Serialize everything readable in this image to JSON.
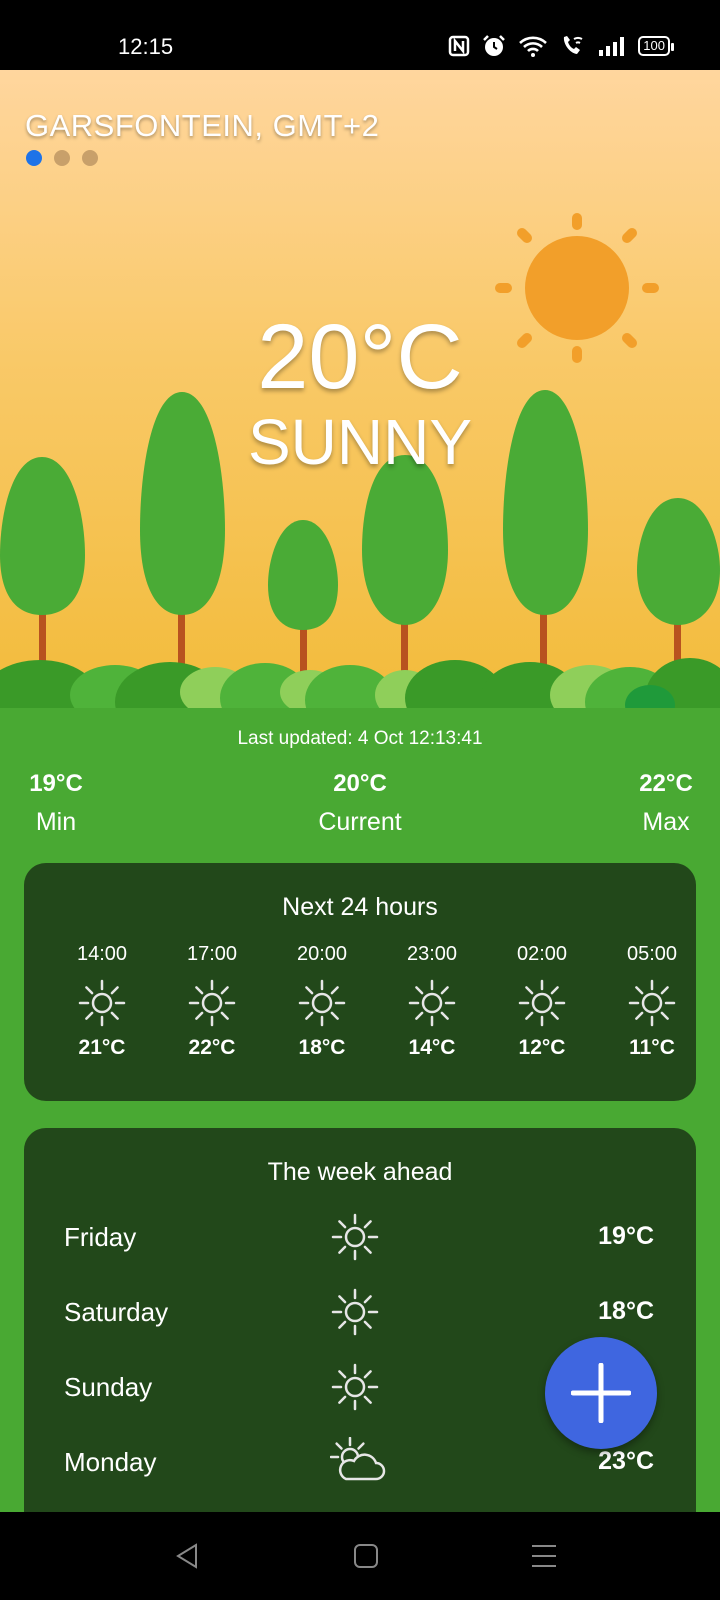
{
  "status_bar": {
    "time": "12:15",
    "battery": "100",
    "icons": [
      "nfc-icon",
      "alarm-icon",
      "wifi-icon",
      "wifi-call-icon",
      "signal-icon",
      "battery-icon"
    ]
  },
  "hero": {
    "location": "GARSFONTEIN, GMT+2",
    "page_dots": 3,
    "active_dot": 0,
    "temperature": "20°C",
    "condition": "SUNNY"
  },
  "summary": {
    "last_updated": "Last updated: 4 Oct 12:13:41",
    "min": {
      "value": "19°C",
      "label": "Min"
    },
    "current": {
      "value": "20°C",
      "label": "Current"
    },
    "max": {
      "value": "22°C",
      "label": "Max"
    }
  },
  "hourly": {
    "title": "Next 24 hours",
    "items": [
      {
        "time": "14:00",
        "icon": "sun-icon",
        "temp": "21°C"
      },
      {
        "time": "17:00",
        "icon": "sun-icon",
        "temp": "22°C"
      },
      {
        "time": "20:00",
        "icon": "sun-icon",
        "temp": "18°C"
      },
      {
        "time": "23:00",
        "icon": "sun-icon",
        "temp": "14°C"
      },
      {
        "time": "02:00",
        "icon": "sun-icon",
        "temp": "12°C"
      },
      {
        "time": "05:00",
        "icon": "sun-icon",
        "temp": "11°C"
      }
    ]
  },
  "weekly": {
    "title": "The week ahead",
    "items": [
      {
        "day": "Friday",
        "icon": "sun-icon",
        "temp": "19°C"
      },
      {
        "day": "Saturday",
        "icon": "sun-icon",
        "temp": "18°C"
      },
      {
        "day": "Sunday",
        "icon": "sun-icon",
        "temp": ""
      },
      {
        "day": "Monday",
        "icon": "partly-cloudy-icon",
        "temp": "23°C"
      }
    ]
  },
  "fab": {
    "icon": "plus-icon"
  },
  "colors": {
    "sky_top": "#ffd69e",
    "sky_bottom": "#f2bb3a",
    "green": "#49a933",
    "card": "#22481a",
    "fab": "#3f66e0",
    "sun": "#f29f2a"
  }
}
